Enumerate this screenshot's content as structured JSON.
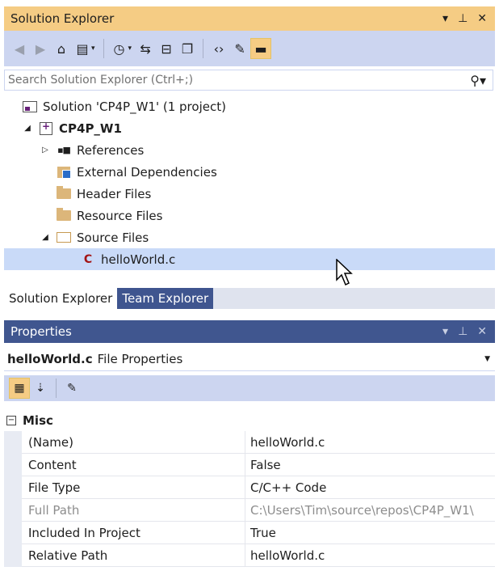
{
  "solution_explorer": {
    "title": "Solution Explorer",
    "title_controls": {
      "dropdown": "▾",
      "pin": "⊥",
      "close": "✕"
    },
    "search": {
      "placeholder": "Search Solution Explorer (Ctrl+;)"
    },
    "toolbar_icons": [
      "back-icon",
      "forward-icon",
      "home-icon",
      "switch-views-icon",
      "pending-changes-icon",
      "sync-icon",
      "collapse-all-icon",
      "show-all-files-icon",
      "view-code-icon",
      "properties-icon",
      "preview-icon"
    ],
    "tree": {
      "solution": "Solution 'CP4P_W1' (1 project)",
      "project": "CP4P_W1",
      "references": "References",
      "external_dependencies": "External Dependencies",
      "header_files": "Header Files",
      "resource_files": "Resource Files",
      "source_files": "Source Files",
      "source_file_icon": "C",
      "selected_file": "helloWorld.c"
    }
  },
  "tabs": {
    "solution_explorer": "Solution Explorer",
    "team_explorer": "Team Explorer"
  },
  "properties": {
    "title": "Properties",
    "title_controls": {
      "dropdown": "▾",
      "pin": "⊥",
      "close": "✕"
    },
    "object_name": "helloWorld.c",
    "object_type": "File Properties",
    "category": "Misc",
    "rows": [
      {
        "name": "(Name)",
        "value": "helloWorld.c"
      },
      {
        "name": "Content",
        "value": "False"
      },
      {
        "name": "File Type",
        "value": "C/C++ Code"
      },
      {
        "name": "Full Path",
        "value": "C:\\Users\\Tim\\source\\repos\\CP4P_W1\\"
      },
      {
        "name": "Included In Project",
        "value": "True"
      },
      {
        "name": "Relative Path",
        "value": "helloWorld.c"
      }
    ]
  },
  "colors": {
    "active_title": "#f5cc84",
    "toolbar_bg": "#ccd5f0",
    "selection": "#c9daf8",
    "inactive_title": "#40568f"
  }
}
